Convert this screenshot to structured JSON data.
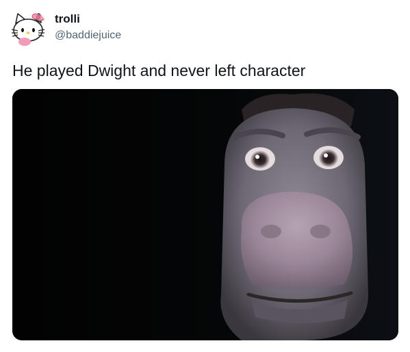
{
  "tweet": {
    "author": {
      "display_name": "trolli",
      "handle": "@baddiejuice",
      "avatar": "hello-kitty-avatar"
    },
    "text": "He played Dwight and never left character",
    "media": {
      "subject": "donkey-face-image"
    }
  }
}
